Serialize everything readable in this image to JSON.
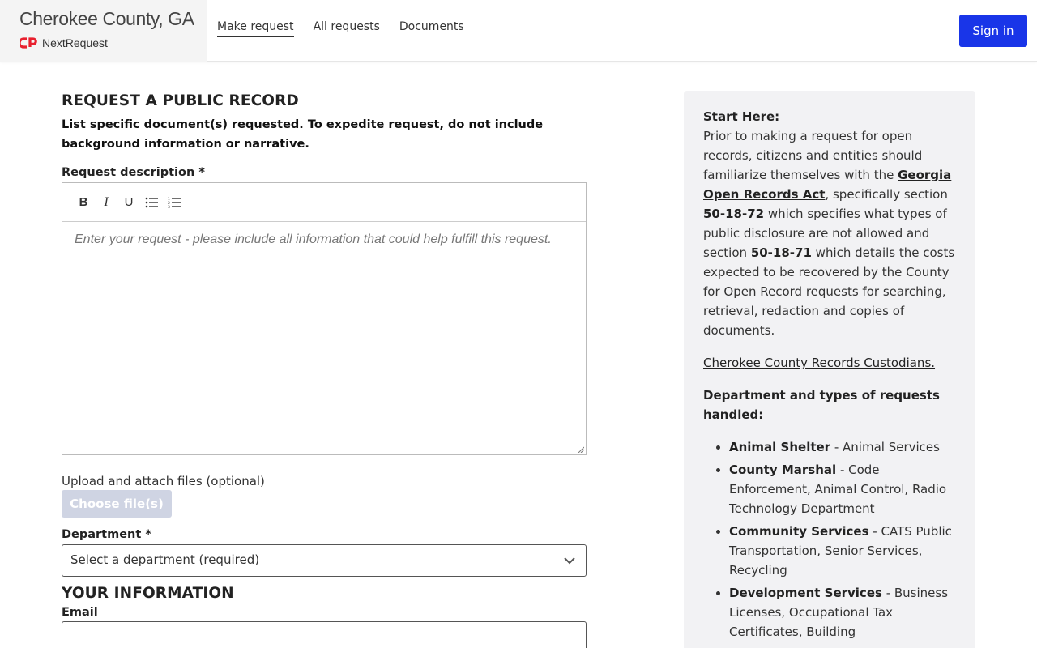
{
  "header": {
    "agency_name": "Cherokee County, GA",
    "brand_name": "NextRequest",
    "nav": [
      "Make request",
      "All requests",
      "Documents"
    ],
    "sign_in": "Sign in",
    "accent_color": "#1935e8",
    "logo_color": "#e8202e"
  },
  "form": {
    "title": "REQUEST A PUBLIC RECORD",
    "lead": "List specific document(s) requested. To expedite request, do not include background information or narrative.",
    "description_label": "Request description *",
    "toolbar": [
      "B",
      "I",
      "U",
      "bulleted-list-icon",
      "numbered-list-icon"
    ],
    "description_placeholder": "Enter your request - please include all information that could help fulfill this request.",
    "upload_label": "Upload and attach files (optional)",
    "choose_files": "Choose file(s)",
    "department_label": "Department *",
    "department_selected": "Select a department (required)",
    "your_info_title": "YOUR INFORMATION",
    "email_label": "Email"
  },
  "sidebar": {
    "start_here": "Start Here:",
    "p1": "Prior to making a request for open records, citizens and entities should familiarize themselves with the",
    "act_link": "Georgia Open Records Act",
    "p2": ", specifically section",
    "sec1": "50-18-72",
    "p3": "which specifies what types of public disclosure are not allowed and section",
    "sec2": "50-18-71",
    "p4": "which details the costs expected to be recovered by the County for Open Record requests for searching, retrieval, redaction and copies of documents.",
    "custodians_link": "Cherokee County Records Custodians.",
    "dept_heading": "Department and types of requests handled:",
    "departments": [
      {
        "name": "Animal Shelter",
        "desc": " - Animal Services"
      },
      {
        "name": "County Marshal",
        "desc": " - Code Enforcement, Animal Control, Radio Technology Department"
      },
      {
        "name": "Community Services",
        "desc": " - CATS Public Transportation, Senior Services, Recycling"
      },
      {
        "name": "Development Services",
        "desc": " - Business Licenses, Occupational Tax Certificates, Building"
      }
    ]
  }
}
